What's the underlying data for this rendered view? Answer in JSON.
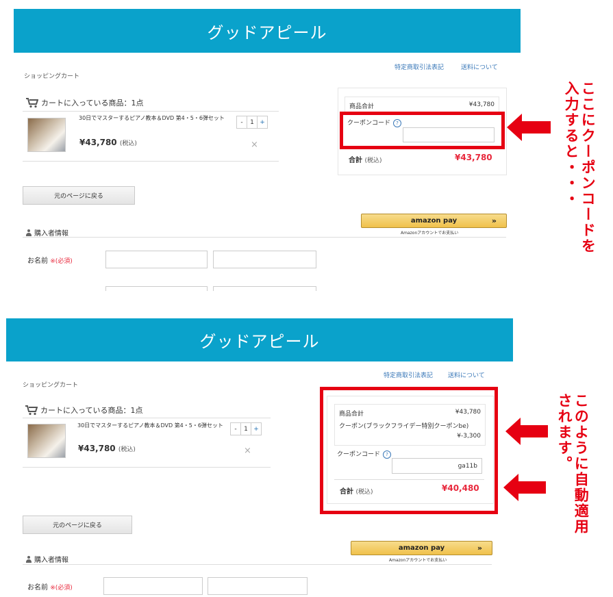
{
  "panel1": {
    "banner_title": "グッドアピール",
    "page_heading": "ショッピングカート",
    "header_links": [
      "特定商取引法表記",
      "送料について"
    ],
    "cart_heading": "カートに入っている商品：1点",
    "product_name": "30日でマスターするピアノ教本＆DVD 第4・5・6弾セット",
    "product_price": "¥43,780",
    "tax_label": "(税込)",
    "qty_minus": "-",
    "qty_value": "1",
    "qty_plus": "+",
    "remove_symbol": "×",
    "back_button": "元のページに戻る",
    "subtotal_label": "商品合計",
    "subtotal_value": "¥43,780",
    "coupon_label": "クーポンコード",
    "coupon_help": "?",
    "coupon_value": "",
    "total_label": "合計",
    "total_tax": "(税込)",
    "total_value": "¥43,780",
    "amazon_label": "amazon pay",
    "amazon_chevron": "»",
    "amazon_sub": "Amazonアカウントでお支払い",
    "buyer_heading": "購入者情報",
    "name_label": "お名前",
    "name_required": "※(必須)"
  },
  "panel2": {
    "banner_title": "グッドアピール",
    "page_heading": "ショッピングカート",
    "header_links": [
      "特定商取引法表記",
      "送料について"
    ],
    "cart_heading": "カートに入っている商品：1点",
    "product_name": "30日でマスターするピアノ教本＆DVD 第4・5・6弾セット",
    "product_price": "¥43,780",
    "tax_label": "(税込)",
    "qty_minus": "-",
    "qty_value": "1",
    "qty_plus": "+",
    "remove_symbol": "×",
    "back_button": "元のページに戻る",
    "subtotal_label": "商品合計",
    "subtotal_value": "¥43,780",
    "discount_label": "クーポン(ブラックフライデー特別クーポンbe)",
    "discount_value": "¥-3,300",
    "coupon_label": "クーポンコード",
    "coupon_help": "?",
    "coupon_value": "ga11b",
    "total_label": "合計",
    "total_tax": "(税込)",
    "total_value": "¥40,480",
    "amazon_label": "amazon pay",
    "amazon_chevron": "»",
    "amazon_sub": "Amazonアカウントでお支払い",
    "buyer_heading": "購入者情報",
    "name_label": "お名前",
    "name_required": "※(必須)"
  },
  "annotations": {
    "top": "ここにクーポンコードを入力すると・・・",
    "top_col1": "ここにクーポンコードを",
    "top_col2": "入力すると・・・",
    "bottom": "このように自動適用されます。",
    "bottom_col1": "このように自動適用",
    "bottom_col2": "されます。"
  },
  "colors": {
    "banner": "#0aa2cb",
    "highlight": "#e60012",
    "price_red": "#e8283c"
  }
}
